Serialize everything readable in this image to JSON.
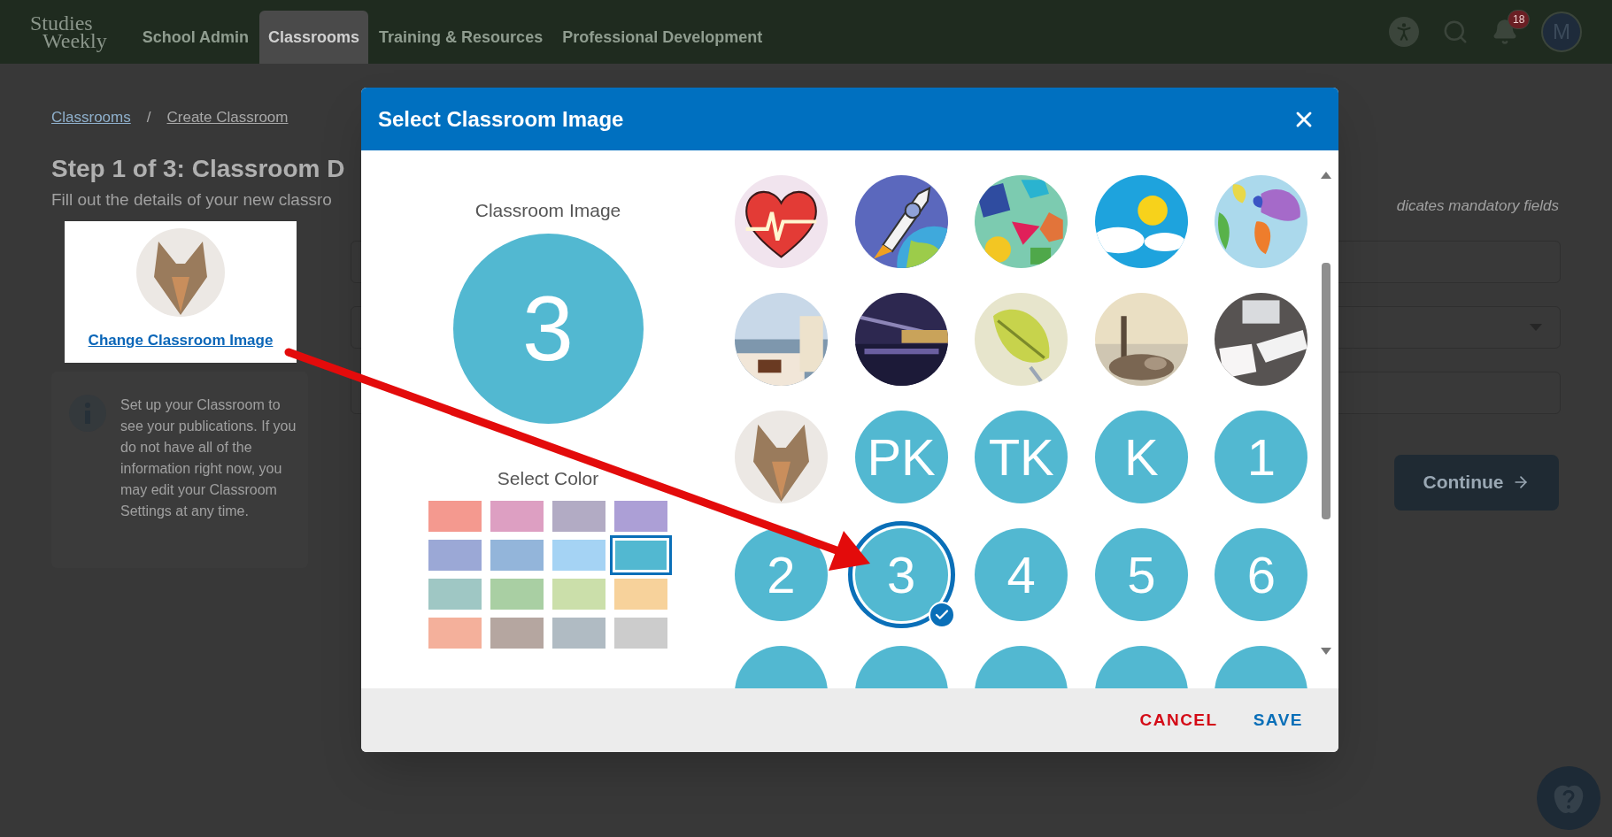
{
  "header": {
    "logo": [
      "Studies",
      "Weekly"
    ],
    "nav": [
      {
        "label": "School Admin",
        "selected": false
      },
      {
        "label": "Classrooms",
        "selected": true
      },
      {
        "label": "Training & Resources",
        "selected": false
      },
      {
        "label": "Professional Development",
        "selected": false
      }
    ],
    "notification_count": "18",
    "avatar_initial": "M"
  },
  "page": {
    "breadcrumb": [
      "Classrooms",
      "Create Classroom"
    ],
    "separator": "/",
    "title": "Step 1 of 3: Classroom D",
    "subtitle": "Fill out the details of your new classro",
    "image_card": {
      "link": "Change Classroom Image"
    },
    "info": "Set up your Classroom to see your publications. If you do not have all of the information right now, you may edit your Classroom Settings at any time.",
    "mandatory_note": "dicates mandatory fields",
    "fields": [
      {
        "kind": "text"
      },
      {
        "kind": "select"
      },
      {
        "kind": "text"
      }
    ],
    "continue_button": "Continue"
  },
  "dialog": {
    "title": "Select Classroom Image",
    "preview_label": "Classroom Image",
    "preview_text": "3",
    "color_label": "Select Color",
    "colors": [
      {
        "color": "#f4998f",
        "selected": false
      },
      {
        "color": "#dd9fc2",
        "selected": false
      },
      {
        "color": "#b2abc4",
        "selected": false
      },
      {
        "color": "#ac9fd6",
        "selected": false
      },
      {
        "color": "#9ba8d6",
        "selected": false
      },
      {
        "color": "#93b5da",
        "selected": false
      },
      {
        "color": "#a5d3f4",
        "selected": false
      },
      {
        "color": "#52b8d1",
        "selected": true
      },
      {
        "color": "#9fc7c4",
        "selected": false
      },
      {
        "color": "#a9cfa3",
        "selected": false
      },
      {
        "color": "#cbdfaa",
        "selected": false
      },
      {
        "color": "#f7d29b",
        "selected": false
      },
      {
        "color": "#f4b09b",
        "selected": false
      },
      {
        "color": "#b5a6a0",
        "selected": false
      },
      {
        "color": "#b0bbc3",
        "selected": false
      },
      {
        "color": "#cccccc",
        "selected": false
      }
    ],
    "images": [
      {
        "kind": "picture",
        "selected": false
      },
      {
        "kind": "picture",
        "selected": false
      },
      {
        "kind": "picture",
        "selected": false
      },
      {
        "kind": "picture",
        "selected": false
      },
      {
        "kind": "picture",
        "selected": false
      },
      {
        "kind": "picture",
        "selected": false
      },
      {
        "kind": "picture",
        "selected": false
      },
      {
        "kind": "picture",
        "selected": false
      },
      {
        "kind": "picture",
        "selected": false
      },
      {
        "kind": "picture",
        "selected": false
      },
      {
        "kind": "picture",
        "selected": false
      },
      {
        "kind": "number",
        "label": "PK",
        "selected": false
      },
      {
        "kind": "number",
        "label": "TK",
        "selected": false
      },
      {
        "kind": "number",
        "label": "K",
        "selected": false
      },
      {
        "kind": "number",
        "label": "1",
        "selected": false
      },
      {
        "kind": "number",
        "label": "2",
        "selected": false
      },
      {
        "kind": "number",
        "label": "3",
        "selected": true
      },
      {
        "kind": "number",
        "label": "4",
        "selected": false
      },
      {
        "kind": "number",
        "label": "5",
        "selected": false
      },
      {
        "kind": "number",
        "label": "6",
        "selected": false
      },
      {
        "kind": "partial",
        "selected": false
      },
      {
        "kind": "partial",
        "selected": false
      },
      {
        "kind": "partial",
        "selected": false
      },
      {
        "kind": "partial",
        "selected": false
      },
      {
        "kind": "partial",
        "selected": false
      }
    ],
    "cancel": "CANCEL",
    "save": "SAVE"
  }
}
